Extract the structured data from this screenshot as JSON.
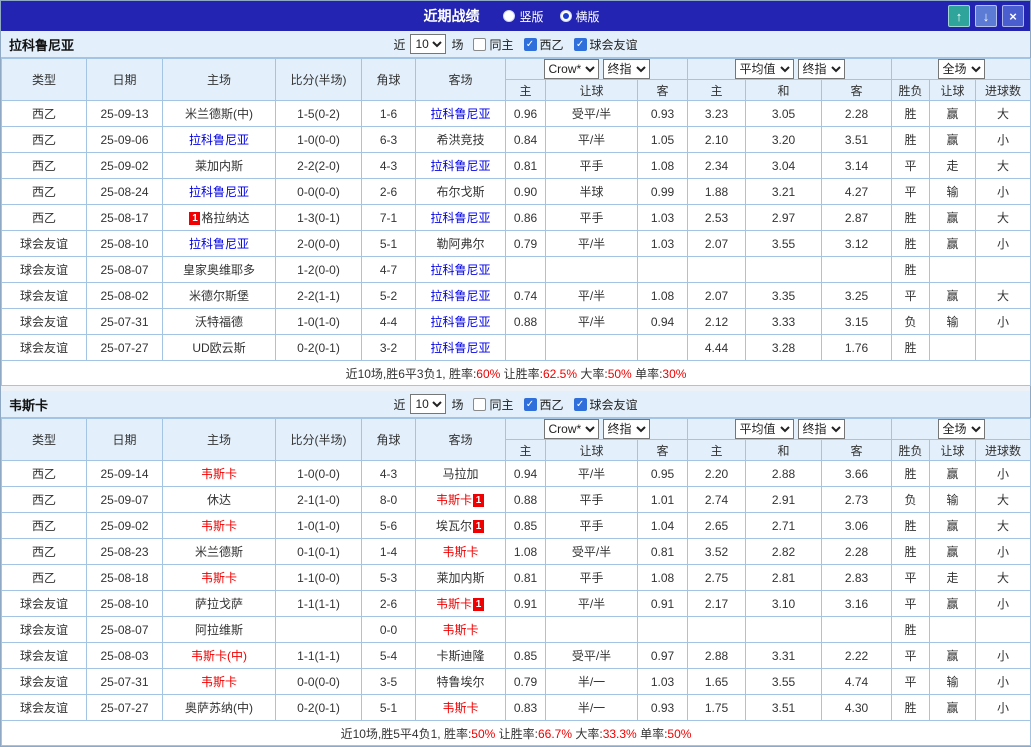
{
  "titlebar": {
    "title": "近期战绩",
    "radio_vertical": "竖版",
    "radio_horizontal": "横版",
    "selected_layout": "横版",
    "buttons": {
      "up": "↑",
      "down": "↓",
      "close": "×"
    }
  },
  "colors": {
    "titlebar_bg": "#2424b2",
    "league_green": "#009933",
    "league_teal": "#00a2a2",
    "win_red": "#f00000",
    "lose_blue": "#0000e6",
    "walk_green": "#009900",
    "header_bg": "#e3effa",
    "grid_border": "#a4c4e4"
  },
  "table_headers": {
    "type": "类型",
    "date": "日期",
    "home": "主场",
    "score": "比分(半场)",
    "corner": "角球",
    "away": "客场",
    "sub": [
      "主",
      "让球",
      "客",
      "主",
      "和",
      "客",
      "胜负",
      "让球",
      "进球数"
    ]
  },
  "sections": [
    {
      "team": "拉科鲁尼亚",
      "filter": {
        "near": "近",
        "count": "10",
        "suffix": "场",
        "options": [
          {
            "key": "same-home",
            "label": "同主",
            "checked": false
          },
          {
            "key": "league",
            "label": "西乙",
            "checked": true
          },
          {
            "key": "friendly",
            "label": "球会友谊",
            "checked": true
          }
        ]
      },
      "selects": {
        "source": "Crow*",
        "source_time": "终指",
        "avg": "平均值",
        "avg_time": "终指",
        "scope": "全场"
      },
      "rows": [
        {
          "league": "西乙",
          "lc": "green",
          "date": "25-09-13",
          "home": {
            "t": "米兰德斯(中)",
            "c": "k",
            "card": ""
          },
          "score": {
            "t": "1-5(0-2)",
            "c": "r"
          },
          "corner": "1-6",
          "away": {
            "t": "拉科鲁尼亚",
            "c": "b",
            "card": ""
          },
          "odds": [
            "0.96",
            "受平/半",
            "0.93"
          ],
          "avg": [
            "3.23",
            "3.05",
            "2.28"
          ],
          "res": [
            [
              "胜",
              "r"
            ],
            [
              "赢",
              "r"
            ],
            [
              "大",
              "r"
            ]
          ]
        },
        {
          "league": "西乙",
          "lc": "green",
          "date": "25-09-06",
          "home": {
            "t": "拉科鲁尼亚",
            "c": "b",
            "card": ""
          },
          "score": {
            "t": "1-0(0-0)",
            "c": "r"
          },
          "corner": "6-3",
          "away": {
            "t": "希洪竞技",
            "c": "k",
            "card": ""
          },
          "odds": [
            "0.84",
            "平/半",
            "1.05"
          ],
          "avg": [
            "2.10",
            "3.20",
            "3.51"
          ],
          "res": [
            [
              "胜",
              "r"
            ],
            [
              "赢",
              "r"
            ],
            [
              "小",
              "b"
            ]
          ]
        },
        {
          "league": "西乙",
          "lc": "green",
          "date": "25-09-02",
          "home": {
            "t": "莱加内斯",
            "c": "k",
            "card": ""
          },
          "score": {
            "t": "2-2(2-0)",
            "c": "r"
          },
          "corner": "4-3",
          "away": {
            "t": "拉科鲁尼亚",
            "c": "b",
            "card": ""
          },
          "odds": [
            "0.81",
            "平手",
            "1.08"
          ],
          "avg": [
            "2.34",
            "3.04",
            "3.14"
          ],
          "res": [
            [
              "平",
              "k"
            ],
            [
              "走",
              "g"
            ],
            [
              "大",
              "r"
            ]
          ]
        },
        {
          "league": "西乙",
          "lc": "green",
          "date": "25-08-24",
          "home": {
            "t": "拉科鲁尼亚",
            "c": "b",
            "card": ""
          },
          "score": {
            "t": "0-0(0-0)",
            "c": "b"
          },
          "corner": "2-6",
          "away": {
            "t": "布尔戈斯",
            "c": "k",
            "card": ""
          },
          "odds": [
            "0.90",
            "半球",
            "0.99"
          ],
          "avg": [
            "1.88",
            "3.21",
            "4.27"
          ],
          "res": [
            [
              "平",
              "k"
            ],
            [
              "输",
              "b"
            ],
            [
              "小",
              "b"
            ]
          ]
        },
        {
          "league": "西乙",
          "lc": "green",
          "date": "25-08-17",
          "home": {
            "t": "格拉纳达",
            "c": "k",
            "card": "before"
          },
          "score": {
            "t": "1-3(0-1)",
            "c": "r"
          },
          "corner": "7-1",
          "away": {
            "t": "拉科鲁尼亚",
            "c": "b",
            "card": ""
          },
          "odds": [
            "0.86",
            "平手",
            "1.03"
          ],
          "avg": [
            "2.53",
            "2.97",
            "2.87"
          ],
          "res": [
            [
              "胜",
              "r"
            ],
            [
              "赢",
              "r"
            ],
            [
              "大",
              "r"
            ]
          ]
        },
        {
          "league": "球会友谊",
          "lc": "teal",
          "date": "25-08-10",
          "home": {
            "t": "拉科鲁尼亚",
            "c": "b",
            "card": ""
          },
          "score": {
            "t": "2-0(0-0)",
            "c": "r"
          },
          "corner": "5-1",
          "away": {
            "t": "勒阿弗尔",
            "c": "k",
            "card": ""
          },
          "odds": [
            "0.79",
            "平/半",
            "1.03"
          ],
          "avg": [
            "2.07",
            "3.55",
            "3.12"
          ],
          "res": [
            [
              "胜",
              "r"
            ],
            [
              "赢",
              "r"
            ],
            [
              "小",
              "b"
            ]
          ]
        },
        {
          "league": "球会友谊",
          "lc": "teal",
          "date": "25-08-07",
          "home": {
            "t": "皇家奥维耶多",
            "c": "k",
            "card": ""
          },
          "score": {
            "t": "1-2(0-0)",
            "c": "r"
          },
          "corner": "4-7",
          "away": {
            "t": "拉科鲁尼亚",
            "c": "b",
            "card": ""
          },
          "odds": [
            "",
            "",
            ""
          ],
          "avg": [
            "",
            "",
            ""
          ],
          "res": [
            [
              "胜",
              "r"
            ],
            [
              "",
              ""
            ],
            [
              "",
              ""
            ]
          ]
        },
        {
          "league": "球会友谊",
          "lc": "teal",
          "date": "25-08-02",
          "home": {
            "t": "米德尔斯堡",
            "c": "k",
            "card": ""
          },
          "score": {
            "t": "2-2(1-1)",
            "c": "r"
          },
          "corner": "5-2",
          "away": {
            "t": "拉科鲁尼亚",
            "c": "b",
            "card": ""
          },
          "odds": [
            "0.74",
            "平/半",
            "1.08"
          ],
          "avg": [
            "2.07",
            "3.35",
            "3.25"
          ],
          "res": [
            [
              "平",
              "k"
            ],
            [
              "赢",
              "r"
            ],
            [
              "大",
              "r"
            ]
          ]
        },
        {
          "league": "球会友谊",
          "lc": "teal",
          "date": "25-07-31",
          "home": {
            "t": "沃特福德",
            "c": "k",
            "card": ""
          },
          "score": {
            "t": "1-0(1-0)",
            "c": "r"
          },
          "corner": "4-4",
          "away": {
            "t": "拉科鲁尼亚",
            "c": "b",
            "card": ""
          },
          "odds": [
            "0.88",
            "平/半",
            "0.94"
          ],
          "avg": [
            "2.12",
            "3.33",
            "3.15"
          ],
          "res": [
            [
              "负",
              "k"
            ],
            [
              "输",
              "b"
            ],
            [
              "小",
              "b"
            ]
          ]
        },
        {
          "league": "球会友谊",
          "lc": "teal",
          "date": "25-07-27",
          "home": {
            "t": "UD欧云斯",
            "c": "k",
            "card": ""
          },
          "score": {
            "t": "0-2(0-1)",
            "c": "r"
          },
          "corner": "3-2",
          "away": {
            "t": "拉科鲁尼亚",
            "c": "b",
            "card": ""
          },
          "odds": [
            "",
            "",
            ""
          ],
          "avg": [
            "4.44",
            "3.28",
            "1.76"
          ],
          "res": [
            [
              "胜",
              "r"
            ],
            [
              "",
              ""
            ],
            [
              "",
              ""
            ]
          ]
        }
      ],
      "summary": [
        [
          "近10场,胜6平3负1, 胜率:",
          "k"
        ],
        [
          "60%",
          "r"
        ],
        [
          " 让胜率:",
          "k"
        ],
        [
          "62.5%",
          "r"
        ],
        [
          " 大率:",
          "k"
        ],
        [
          "50%",
          "r"
        ],
        [
          " 单率:",
          "k"
        ],
        [
          "30%",
          "r"
        ]
      ]
    },
    {
      "team": "韦斯卡",
      "filter": {
        "near": "近",
        "count": "10",
        "suffix": "场",
        "options": [
          {
            "key": "same-home",
            "label": "同主",
            "checked": false
          },
          {
            "key": "league",
            "label": "西乙",
            "checked": true
          },
          {
            "key": "friendly",
            "label": "球会友谊",
            "checked": true
          }
        ]
      },
      "selects": {
        "source": "Crow*",
        "source_time": "终指",
        "avg": "平均值",
        "avg_time": "终指",
        "scope": "全场"
      },
      "rows": [
        {
          "league": "西乙",
          "lc": "green",
          "date": "25-09-14",
          "home": {
            "t": "韦斯卡",
            "c": "r",
            "card": ""
          },
          "score": {
            "t": "1-0(0-0)",
            "c": "r"
          },
          "corner": "4-3",
          "away": {
            "t": "马拉加",
            "c": "k",
            "card": ""
          },
          "odds": [
            "0.94",
            "平/半",
            "0.95"
          ],
          "avg": [
            "2.20",
            "2.88",
            "3.66"
          ],
          "res": [
            [
              "胜",
              "r"
            ],
            [
              "赢",
              "r"
            ],
            [
              "小",
              "b"
            ]
          ]
        },
        {
          "league": "西乙",
          "lc": "green",
          "date": "25-09-07",
          "home": {
            "t": "休达",
            "c": "k",
            "card": ""
          },
          "score": {
            "t": "2-1(1-0)",
            "c": "r"
          },
          "corner": "8-0",
          "away": {
            "t": "韦斯卡",
            "c": "r",
            "card": "after"
          },
          "odds": [
            "0.88",
            "平手",
            "1.01"
          ],
          "avg": [
            "2.74",
            "2.91",
            "2.73"
          ],
          "res": [
            [
              "负",
              "k"
            ],
            [
              "输",
              "b"
            ],
            [
              "大",
              "r"
            ]
          ]
        },
        {
          "league": "西乙",
          "lc": "green",
          "date": "25-09-02",
          "home": {
            "t": "韦斯卡",
            "c": "r",
            "card": ""
          },
          "score": {
            "t": "1-0(1-0)",
            "c": "r"
          },
          "corner": "5-6",
          "away": {
            "t": "埃瓦尔",
            "c": "k",
            "card": "after"
          },
          "odds": [
            "0.85",
            "平手",
            "1.04"
          ],
          "avg": [
            "2.65",
            "2.71",
            "3.06"
          ],
          "res": [
            [
              "胜",
              "r"
            ],
            [
              "赢",
              "r"
            ],
            [
              "大",
              "r"
            ]
          ]
        },
        {
          "league": "西乙",
          "lc": "green",
          "date": "25-08-23",
          "home": {
            "t": "米兰德斯",
            "c": "k",
            "card": ""
          },
          "score": {
            "t": "0-1(0-1)",
            "c": "b"
          },
          "corner": "1-4",
          "away": {
            "t": "韦斯卡",
            "c": "r",
            "card": ""
          },
          "odds": [
            "1.08",
            "受平/半",
            "0.81"
          ],
          "avg": [
            "3.52",
            "2.82",
            "2.28"
          ],
          "res": [
            [
              "胜",
              "r"
            ],
            [
              "赢",
              "r"
            ],
            [
              "小",
              "b"
            ]
          ]
        },
        {
          "league": "西乙",
          "lc": "green",
          "date": "25-08-18",
          "home": {
            "t": "韦斯卡",
            "c": "r",
            "card": ""
          },
          "score": {
            "t": "1-1(0-0)",
            "c": "r"
          },
          "corner": "5-3",
          "away": {
            "t": "莱加内斯",
            "c": "k",
            "card": ""
          },
          "odds": [
            "0.81",
            "平手",
            "1.08"
          ],
          "avg": [
            "2.75",
            "2.81",
            "2.83"
          ],
          "res": [
            [
              "平",
              "k"
            ],
            [
              "走",
              "g"
            ],
            [
              "大",
              "r"
            ]
          ]
        },
        {
          "league": "球会友谊",
          "lc": "teal",
          "date": "25-08-10",
          "home": {
            "t": "萨拉戈萨",
            "c": "k",
            "card": ""
          },
          "score": {
            "t": "1-1(1-1)",
            "c": "r"
          },
          "corner": "2-6",
          "away": {
            "t": "韦斯卡",
            "c": "r",
            "card": "after"
          },
          "odds": [
            "0.91",
            "平/半",
            "0.91"
          ],
          "avg": [
            "2.17",
            "3.10",
            "3.16"
          ],
          "res": [
            [
              "平",
              "k"
            ],
            [
              "赢",
              "r"
            ],
            [
              "小",
              "b"
            ]
          ]
        },
        {
          "league": "球会友谊",
          "lc": "teal",
          "date": "25-08-07",
          "home": {
            "t": "阿拉维斯",
            "c": "k",
            "card": ""
          },
          "score": {
            "t": "",
            "c": "k"
          },
          "corner": "0-0",
          "away": {
            "t": "韦斯卡",
            "c": "r",
            "card": ""
          },
          "odds": [
            "",
            "",
            ""
          ],
          "avg": [
            "",
            "",
            ""
          ],
          "res": [
            [
              "胜",
              "r"
            ],
            [
              "",
              ""
            ],
            [
              "",
              ""
            ]
          ]
        },
        {
          "league": "球会友谊",
          "lc": "teal",
          "date": "25-08-03",
          "home": {
            "t": "韦斯卡(中)",
            "c": "r",
            "card": ""
          },
          "score": {
            "t": "1-1(1-1)",
            "c": "r"
          },
          "corner": "5-4",
          "away": {
            "t": "卡斯迪隆",
            "c": "k",
            "card": ""
          },
          "odds": [
            "0.85",
            "受平/半",
            "0.97"
          ],
          "avg": [
            "2.88",
            "3.31",
            "2.22"
          ],
          "res": [
            [
              "平",
              "k"
            ],
            [
              "赢",
              "r"
            ],
            [
              "小",
              "b"
            ]
          ]
        },
        {
          "league": "球会友谊",
          "lc": "teal",
          "date": "25-07-31",
          "home": {
            "t": "韦斯卡",
            "c": "r",
            "card": ""
          },
          "score": {
            "t": "0-0(0-0)",
            "c": "b"
          },
          "corner": "3-5",
          "away": {
            "t": "特鲁埃尔",
            "c": "k",
            "card": ""
          },
          "odds": [
            "0.79",
            "半/一",
            "1.03"
          ],
          "avg": [
            "1.65",
            "3.55",
            "4.74"
          ],
          "res": [
            [
              "平",
              "k"
            ],
            [
              "输",
              "b"
            ],
            [
              "小",
              "b"
            ]
          ]
        },
        {
          "league": "球会友谊",
          "lc": "teal",
          "date": "25-07-27",
          "home": {
            "t": "奥萨苏纳(中)",
            "c": "k",
            "card": ""
          },
          "score": {
            "t": "0-2(0-1)",
            "c": "r"
          },
          "corner": "5-1",
          "away": {
            "t": "韦斯卡",
            "c": "r",
            "card": ""
          },
          "odds": [
            "0.83",
            "半/一",
            "0.93"
          ],
          "avg": [
            "1.75",
            "3.51",
            "4.30"
          ],
          "res": [
            [
              "胜",
              "r"
            ],
            [
              "赢",
              "r"
            ],
            [
              "小",
              "b"
            ]
          ]
        }
      ],
      "summary": [
        [
          "近10场,胜5平4负1, 胜率:",
          "k"
        ],
        [
          "50%",
          "r"
        ],
        [
          " 让胜率:",
          "k"
        ],
        [
          "66.7%",
          "r"
        ],
        [
          " 大率:",
          "k"
        ],
        [
          "33.3%",
          "r"
        ],
        [
          " 单率:",
          "k"
        ],
        [
          "50%",
          "r"
        ]
      ]
    }
  ]
}
